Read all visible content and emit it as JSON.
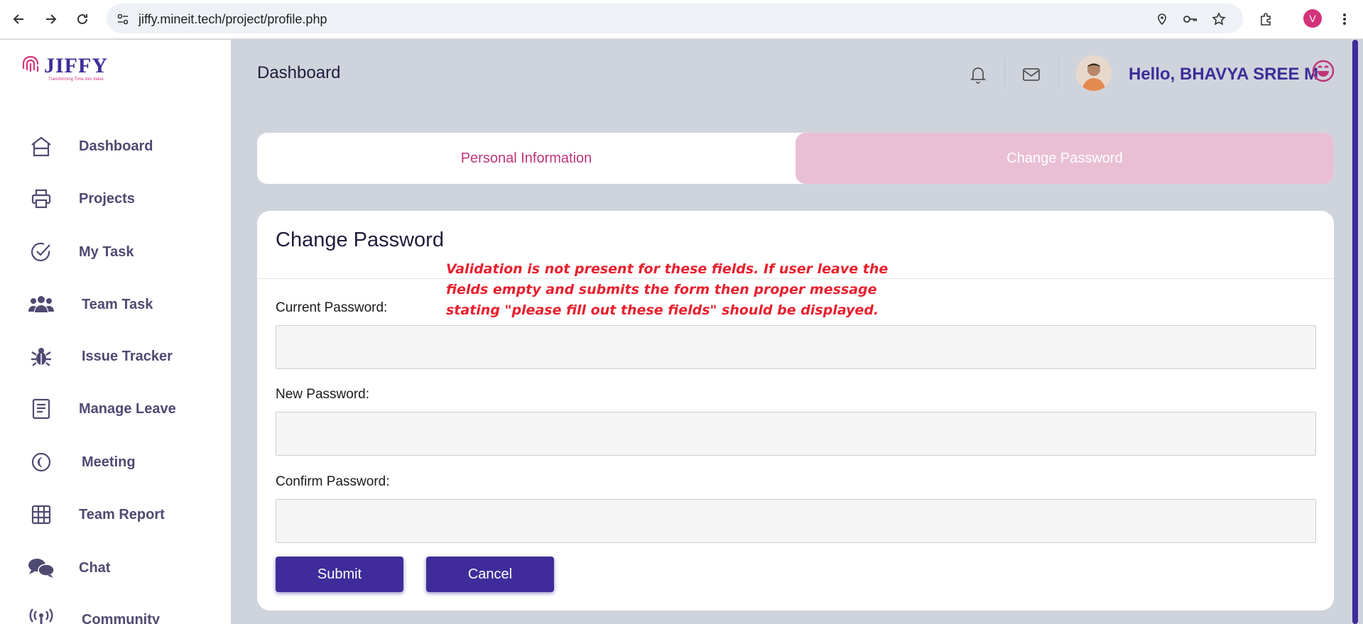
{
  "browser": {
    "url": "jiffy.mineit.tech/project/profile.php",
    "profile_initial": "V"
  },
  "sidebar": {
    "logo_text": "JIFFY",
    "logo_tagline": "Transforming Time into Value",
    "items": [
      {
        "label": "Dashboard",
        "icon": "home-icon"
      },
      {
        "label": "Projects",
        "icon": "printer-icon"
      },
      {
        "label": "My Task",
        "icon": "check-circle-icon"
      },
      {
        "label": "Team Task",
        "icon": "users-icon"
      },
      {
        "label": "Issue Tracker",
        "icon": "bug-icon"
      },
      {
        "label": "Manage Leave",
        "icon": "document-icon"
      },
      {
        "label": "Meeting",
        "icon": "moon-circle-icon"
      },
      {
        "label": "Team Report",
        "icon": "grid-icon"
      },
      {
        "label": "Chat",
        "icon": "chat-bubbles-icon"
      },
      {
        "label": "Community",
        "icon": "broadcast-icon"
      }
    ]
  },
  "header": {
    "title": "Dashboard",
    "greeting": "Hello, BHAVYA SREE M"
  },
  "tabs": {
    "personal": "Personal Information",
    "change_password": "Change Password",
    "active": "change_password"
  },
  "form": {
    "title": "Change Password",
    "annotation": "Validation is not present for these fields. If user leave the fields empty and submits the form then proper message stating \"please fill out these fields\" should be displayed.",
    "current_label": "Current Password:",
    "current_value": "",
    "new_label": "New Password:",
    "new_value": "",
    "confirm_label": "Confirm Password:",
    "confirm_value": "",
    "submit_label": "Submit",
    "cancel_label": "Cancel"
  },
  "colors": {
    "brand": "#3f2c9a",
    "accent": "#c0357a",
    "tab_active_bg": "#e9bfd4",
    "annotation": "#e8202e"
  }
}
